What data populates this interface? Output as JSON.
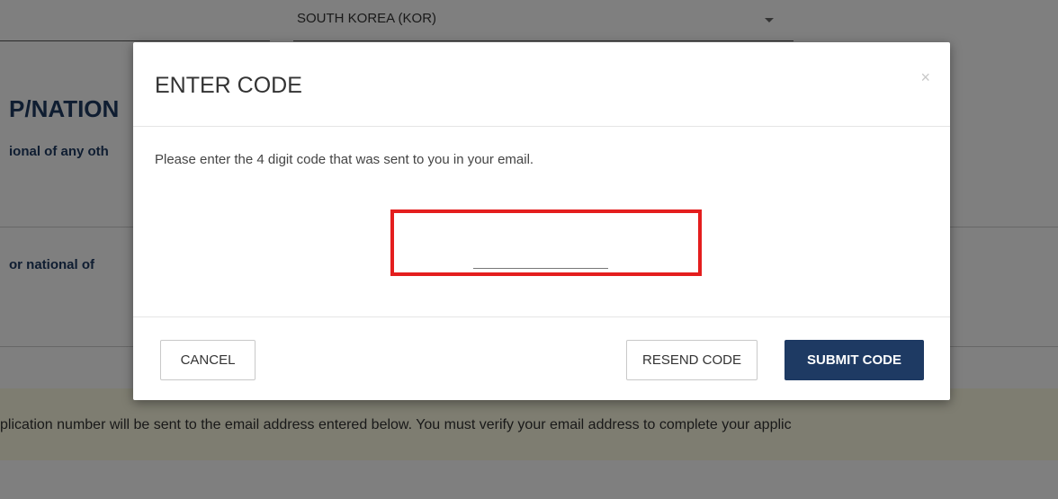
{
  "background": {
    "country_select": {
      "value": "SOUTH KOREA (KOR)"
    },
    "section_heading": "P/NATION",
    "question_1": "ional of any oth",
    "question_2": "or national of",
    "notice_text": "plication number will be sent to the email address entered below. You must verify your email address to complete your applic"
  },
  "modal": {
    "title": "ENTER CODE",
    "close_label": "×",
    "instructions": "Please enter the 4 digit code that was sent to you in your email.",
    "code_input": {
      "value": "",
      "placeholder": ""
    },
    "buttons": {
      "cancel": "CANCEL",
      "resend": "RESEND CODE",
      "submit": "SUBMIT CODE"
    }
  },
  "colors": {
    "primary_navy": "#1e3a63",
    "highlight_red": "#e41e1e",
    "notice_yellow": "#fdfbe2"
  }
}
